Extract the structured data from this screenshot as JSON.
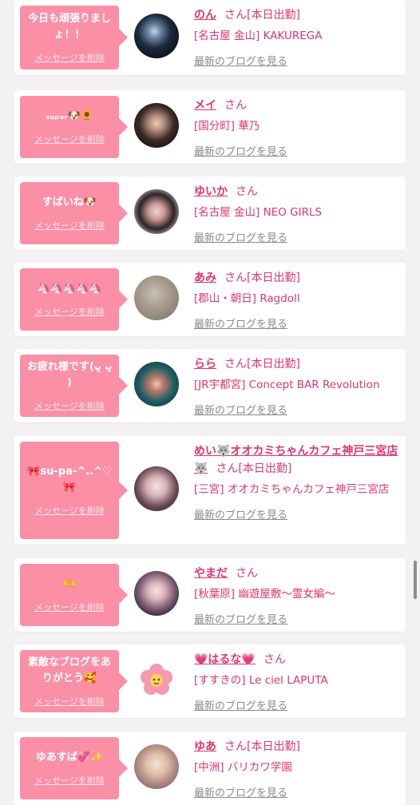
{
  "colors": {
    "accent": "#e1346e",
    "bubble": "#fb8fa6",
    "background": "#f3f1f2"
  },
  "entries": [
    {
      "message": "今日も頑張りましょ！！",
      "delete_label": "メッセージを削除",
      "name": "のん",
      "honorific": "さん",
      "status": "[本日出勤]",
      "shop": "[名古屋 金山] KAKUREGA",
      "blog_link": "最新のブログを見る",
      "avatar": "dark-portrait-avatar"
    },
    {
      "message": "ₛᵤₚₑᵣ🐶🌻",
      "delete_label": "メッセージを削除",
      "name": "メイ",
      "honorific": "さん",
      "status": "",
      "shop": "[国分町] 華乃",
      "blog_link": "最新のブログを見る",
      "avatar": "woman-avatar"
    },
    {
      "message": "すばいね🐶",
      "delete_label": "メッセージを削除",
      "name": "ゆいか",
      "honorific": "さん",
      "status": "",
      "shop": "[名古屋 金山] NEO GIRLS",
      "blog_link": "最新のブログを見る",
      "avatar": "girl-avatar"
    },
    {
      "message": "🦄🦄🦄🦄🦄",
      "delete_label": "メッセージを削除",
      "name": "あみ",
      "honorific": "さん",
      "status": "[本日出勤]",
      "shop": "[郡山・朝日] Ragdoll",
      "blog_link": "最新のブログを見る",
      "avatar": "hair-avatar"
    },
    {
      "message": "お疲れ様です(ᴗ͈ ᴗ͈ )",
      "delete_label": "メッセージを削除",
      "name": "らら",
      "honorific": "さん",
      "status": "[本日出勤]",
      "shop": "[JR宇都宮] Concept BAR Revolution",
      "blog_link": "最新のブログを見る",
      "avatar": "teal-avatar"
    },
    {
      "message": "🎀su-pa-^..^♡🎀",
      "delete_label": "メッセージを削除",
      "name": "めい🐺オオカミちゃんカフェ神戸三宮店🐺",
      "honorific": "さん",
      "status": "[本日出勤]",
      "shop": "[三宮] オオカミちゃんカフェ神戸三宮店",
      "blog_link": "最新のブログを見る",
      "avatar": "pink-girl-avatar"
    },
    {
      "message": "🫶",
      "delete_label": "メッセージを削除",
      "name": "やまだ",
      "honorific": "さん",
      "status": "",
      "shop": "[秋葉原] 幽遊屋敷〜霊女編〜",
      "blog_link": "最新のブログを見る",
      "avatar": "costume-avatar"
    },
    {
      "message": "素敵なブログをありがとう🥰",
      "delete_label": "メッセージを削除",
      "name": "💗はるな💗",
      "honorific": "さん",
      "status": "",
      "shop": "[すすきの] Le ciel LAPUTA",
      "blog_link": "最新のブログを見る",
      "avatar": "flower-icon"
    },
    {
      "message": "ゆあすば💞✨",
      "delete_label": "メッセージを削除",
      "name": "ゆあ",
      "honorific": "さん",
      "status": "[本日出勤]",
      "shop": "[中洲] バリカワ学園",
      "blog_link": "最新のブログを見る",
      "avatar": "blonde-avatar"
    }
  ]
}
